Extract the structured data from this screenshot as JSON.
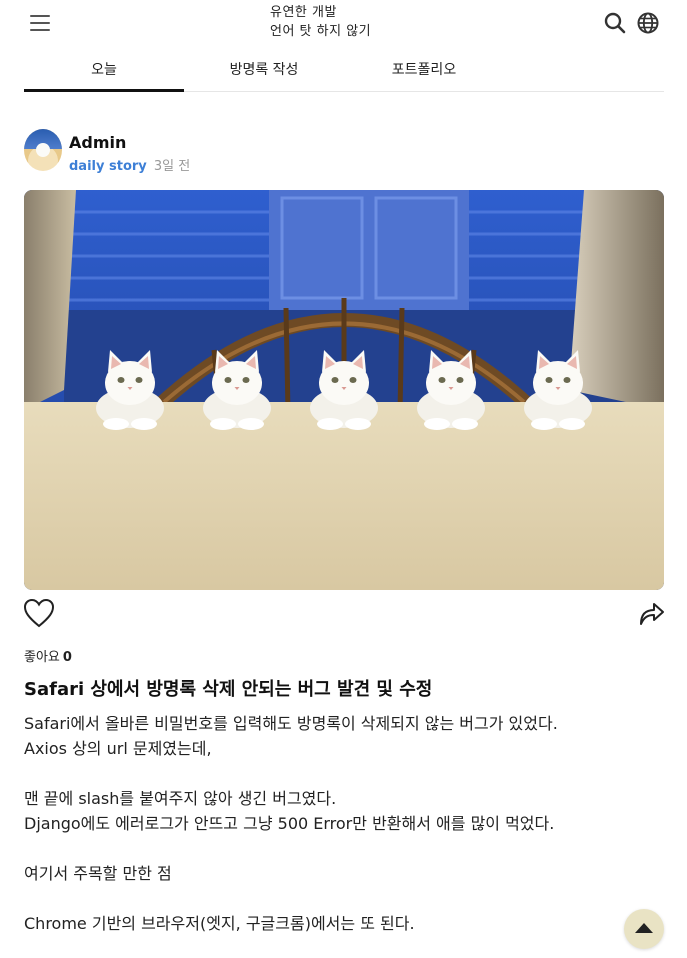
{
  "header": {
    "menu_icon": "hamburger-menu-icon",
    "title_line1": "유연한 개발",
    "title_line2": "언어 탓 하지 않기",
    "search_icon": "search-icon",
    "language_icon": "globe-icon"
  },
  "tabs": [
    {
      "label": "오늘",
      "active": true
    },
    {
      "label": "방명록 작성",
      "active": false
    },
    {
      "label": "포트폴리오",
      "active": false
    }
  ],
  "author": {
    "name": "Admin",
    "category": "daily story",
    "time": "3일 전"
  },
  "actions": {
    "like_icon": "heart-outline-icon",
    "share_icon": "share-arrow-icon",
    "likes_label": "좋아요",
    "likes_count": "0"
  },
  "post": {
    "title": "Safari 상에서 방명록 삭제 안되는 버그 발견 및 수정",
    "paragraphs": [
      "Safari에서 올바른 비밀번호를 입력해도 방명록이 삭제되지 않는 버그가 있었다.",
      "Axios 상의 url 문제였는데,",
      "",
      "맨 끝에 slash를 붙여주지 않아 생긴 버그였다.",
      "Django에도 에러로그가 안뜨고 그냥 500 Error만 반환해서 애를 많이 먹었다.",
      "",
      "여기서 주목할 만한 점",
      "",
      "Chrome 기반의 브라우저(엣지, 구글크롬)에서는 또 된다."
    ]
  },
  "scroll_top_icon": "arrow-up-icon",
  "colors": {
    "accent": "#3d7fd6",
    "scroll_button": "#e9e3c4"
  }
}
